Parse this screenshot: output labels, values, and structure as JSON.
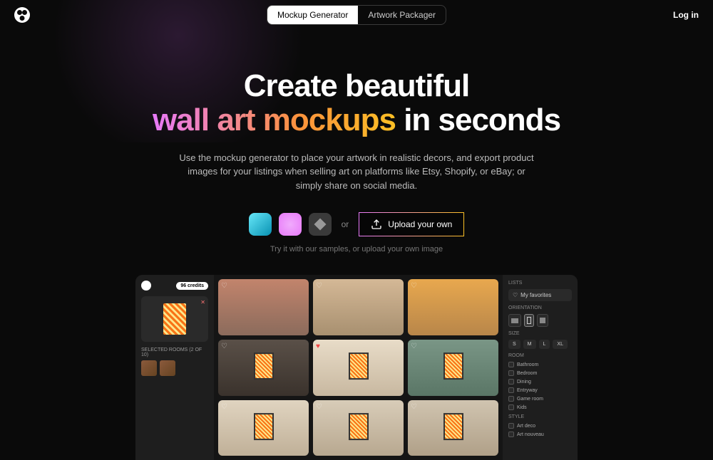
{
  "header": {
    "tabs": [
      "Mockup Generator",
      "Artwork Packager"
    ],
    "login": "Log in"
  },
  "hero": {
    "title_line1": "Create beautiful",
    "title_gradient": "wall art mockups",
    "title_line2_rest": " in seconds",
    "subtitle": "Use the mockup generator to place your artwork in realistic decors, and export product images for your listings when selling art on platforms like Etsy, Shopify, or eBay; or simply share on social media.",
    "or": "or",
    "upload_label": "Upload your own",
    "hint": "Try it with our samples, or upload your own image"
  },
  "preview": {
    "credits": "96 credits",
    "selected_rooms_label": "SELECTED ROOMS (2 OF 10)",
    "lists_label": "LISTS",
    "favorites_label": "My favorites",
    "orientation_label": "ORIENTATION",
    "size_label": "SIZE",
    "sizes": [
      "S",
      "M",
      "L",
      "XL"
    ],
    "room_label": "ROOM",
    "rooms": [
      "Bathroom",
      "Bedroom",
      "Dining",
      "Entryway",
      "Game room",
      "Kids"
    ],
    "style_label": "STYLE",
    "styles": [
      "Art deco",
      "Art nouveau"
    ]
  }
}
